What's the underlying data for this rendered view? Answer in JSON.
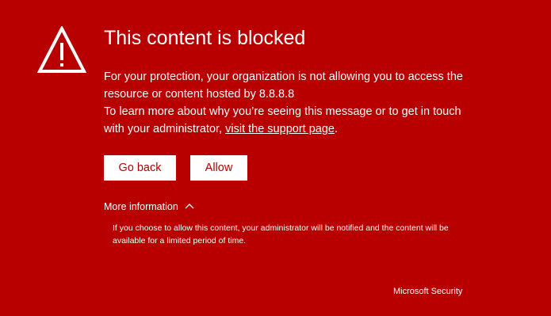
{
  "icons": {
    "warning": "warning-triangle-icon",
    "chevron": "chevron-up-icon"
  },
  "colors": {
    "background": "#b80000",
    "text": "#ffffff",
    "button_bg": "#ffffff",
    "button_text": "#b80000"
  },
  "page": {
    "title": "This content is blocked",
    "message_line1": "For your protection, your organization is not allowing you to access the resource or content hosted by 8.8.8.8",
    "message_line2_prefix": "To learn more about why you’re seeing this message or to get in touch with your administrator, ",
    "support_link": "visit the support page",
    "message_line2_suffix": "."
  },
  "buttons": {
    "go_back": "Go back",
    "allow": "Allow"
  },
  "more_info": {
    "label": "More information",
    "details": "If you choose to allow this content, your administrator will be notified and the content will be available for a limited period of time."
  },
  "footer": {
    "brand": "Microsoft Security"
  }
}
